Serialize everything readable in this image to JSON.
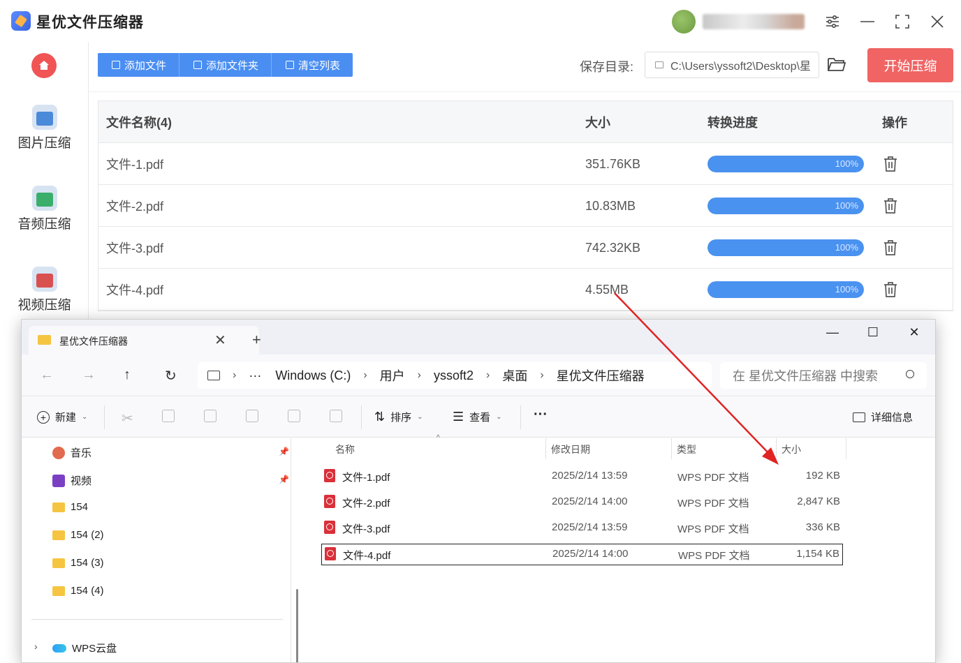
{
  "app": {
    "title": "星优文件压缩器",
    "sidebar": {
      "items": [
        {
          "label": "图片压缩",
          "icon": "image-icon"
        },
        {
          "label": "音频压缩",
          "icon": "audio-icon"
        },
        {
          "label": "视频压缩",
          "icon": "video-icon"
        }
      ]
    },
    "toolbar": {
      "add_file": "添加文件",
      "add_folder": "添加文件夹",
      "clear_list": "清空列表"
    },
    "save_dir": {
      "label": "保存目录:",
      "value": "C:\\Users\\yssoft2\\Desktop\\星"
    },
    "start_button": "开始压缩",
    "table": {
      "headers": [
        "文件名称(4)",
        "大小",
        "转换进度",
        "操作"
      ],
      "rows": [
        {
          "name": "文件-1.pdf",
          "size": "351.76KB",
          "progress_text": "100%",
          "progress": 100
        },
        {
          "name": "文件-2.pdf",
          "size": "10.83MB",
          "progress_text": "100%",
          "progress": 100
        },
        {
          "name": "文件-3.pdf",
          "size": "742.32KB",
          "progress_text": "100%",
          "progress": 100
        },
        {
          "name": "文件-4.pdf",
          "size": "4.55MB",
          "progress_text": "100%",
          "progress": 100
        }
      ]
    }
  },
  "explorer": {
    "tab_title": "星优文件压缩器",
    "breadcrumb": [
      "Windows (C:)",
      "用户",
      "yssoft2",
      "桌面",
      "星优文件压缩器"
    ],
    "breadcrumb_more": "···",
    "search_placeholder": "在 星优文件压缩器 中搜索",
    "commands": {
      "new": "新建",
      "sort": "排序",
      "view": "查看",
      "more": "···",
      "details": "详细信息"
    },
    "nav": [
      {
        "label": "音乐",
        "pinned": true,
        "icon": "music-icon"
      },
      {
        "label": "视频",
        "pinned": true,
        "icon": "video-icon"
      },
      {
        "label": "154",
        "pinned": false,
        "icon": "folder-icon"
      },
      {
        "label": "154 (2)",
        "pinned": false,
        "icon": "folder-icon"
      },
      {
        "label": "154 (3)",
        "pinned": false,
        "icon": "folder-icon"
      },
      {
        "label": "154 (4)",
        "pinned": false,
        "icon": "folder-icon"
      },
      {
        "label": "WPS云盘",
        "pinned": false,
        "icon": "cloud-icon"
      }
    ],
    "columns": [
      "名称",
      "修改日期",
      "类型",
      "大小"
    ],
    "files": [
      {
        "name": "文件-1.pdf",
        "date": "2025/2/14 13:59",
        "type": "WPS PDF 文档",
        "size": "192 KB",
        "selected": false
      },
      {
        "name": "文件-2.pdf",
        "date": "2025/2/14 14:00",
        "type": "WPS PDF 文档",
        "size": "2,847 KB",
        "selected": false
      },
      {
        "name": "文件-3.pdf",
        "date": "2025/2/14 13:59",
        "type": "WPS PDF 文档",
        "size": "336 KB",
        "selected": false
      },
      {
        "name": "文件-4.pdf",
        "date": "2025/2/14 14:00",
        "type": "WPS PDF 文档",
        "size": "1,154 KB",
        "selected": true
      }
    ]
  },
  "colors": {
    "accent_blue": "#4a8ef2",
    "start_red": "#f06464",
    "progress_blue": "#4a92f0",
    "annotation_arrow": "#e02424"
  }
}
